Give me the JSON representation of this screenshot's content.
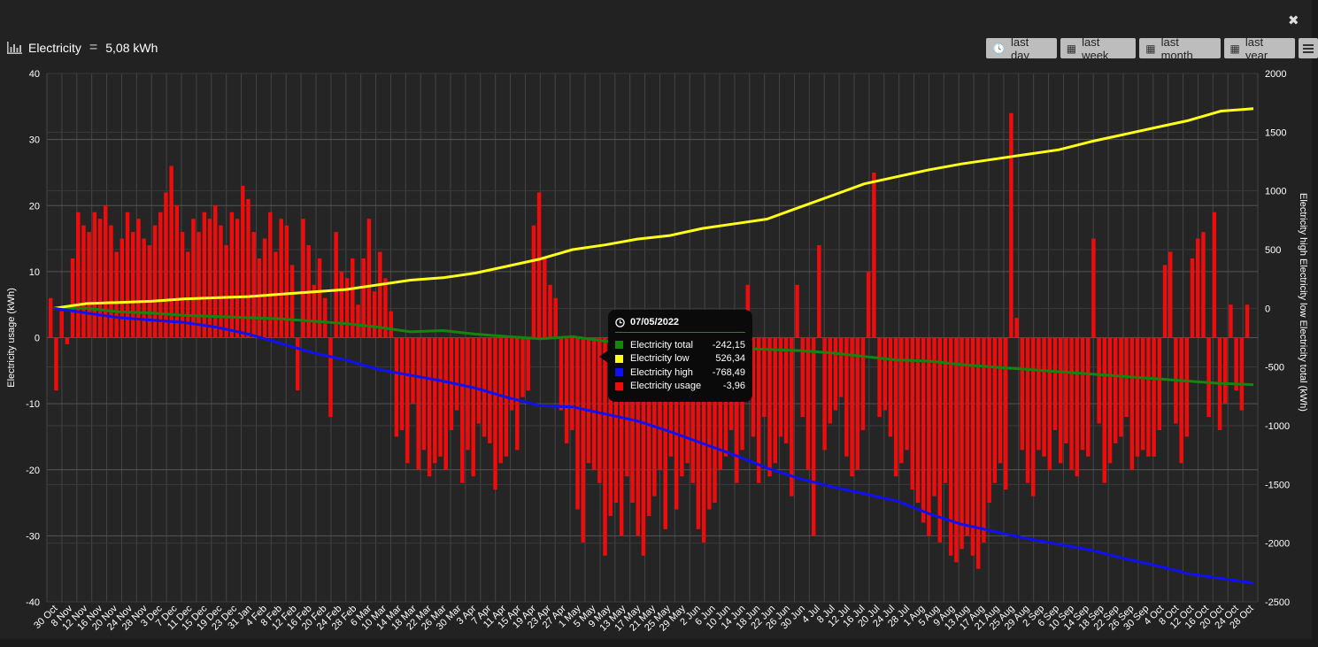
{
  "window": {
    "close_icon": "close-icon"
  },
  "header": {
    "icon": "bar-chart-icon",
    "title": "Electricity",
    "equals": "=",
    "value": "5,08 kWh"
  },
  "range_buttons": [
    {
      "label": "last day",
      "icon": "clock-icon"
    },
    {
      "label": "last week",
      "icon": "calendar-icon"
    },
    {
      "label": "last month",
      "icon": "calendar-icon"
    },
    {
      "label": "last year",
      "icon": "calendar-icon"
    }
  ],
  "menu_icon": "hamburger-menu-icon",
  "colors": {
    "total": "#14850f",
    "low": "#ffff1a",
    "high": "#1010f0",
    "usage": "#ee0c0c",
    "grid": "#4a4a4a",
    "background": "#222222"
  },
  "tooltip": {
    "date": "07/05/2022",
    "rows": [
      {
        "name": "Electricity total",
        "value": "-242,15",
        "color": "#14850f"
      },
      {
        "name": "Electricity low",
        "value": "526,34",
        "color": "#ffff1a"
      },
      {
        "name": "Electricity high",
        "value": "-768,49",
        "color": "#1010f0"
      },
      {
        "name": "Electricity usage",
        "value": "-3,96",
        "color": "#ee0c0c"
      }
    ]
  },
  "chart_data": {
    "type": "bar+line",
    "grid": true,
    "y_left": {
      "label": "Electricity usage (kWh)",
      "min": -40,
      "max": 40,
      "ticks": [
        40,
        30,
        20,
        10,
        0,
        -10,
        -20,
        -30,
        -40
      ]
    },
    "y_right": {
      "label": "Electricity high Electricity low Electricity total (kWh)",
      "min": -2500,
      "max": 2000,
      "ticks": [
        2000,
        1500,
        1000,
        500,
        0,
        -500,
        -1000,
        -1500,
        -2000,
        -2500
      ]
    },
    "x_ticks": [
      "30 Oct",
      "8 Nov",
      "12 Nov",
      "16 Nov",
      "20 Nov",
      "24 Nov",
      "28 Nov",
      "3 Dec",
      "7 Dec",
      "11 Dec",
      "15 Dec",
      "19 Dec",
      "23 Dec",
      "31 Jan",
      "4 Feb",
      "8 Feb",
      "12 Feb",
      "16 Feb",
      "20 Feb",
      "24 Feb",
      "28 Feb",
      "6 Mar",
      "10 Mar",
      "14 Mar",
      "18 Mar",
      "22 Mar",
      "26 Mar",
      "30 Mar",
      "3 Apr",
      "7 Apr",
      "11 Apr",
      "15 Apr",
      "19 Apr",
      "23 Apr",
      "27 Apr",
      "1 May",
      "5 May",
      "9 May",
      "13 May",
      "17 May",
      "21 May",
      "25 May",
      "29 May",
      "2 Jun",
      "6 Jun",
      "10 Jun",
      "14 Jun",
      "18 Jun",
      "22 Jun",
      "26 Jun",
      "30 Jun",
      "4 Jul",
      "8 Jul",
      "12 Jul",
      "16 Jul",
      "20 Jul",
      "24 Jul",
      "28 Jul",
      "1 Aug",
      "5 Aug",
      "9 Aug",
      "13 Aug",
      "17 Aug",
      "21 Aug",
      "25 Aug",
      "29 Aug",
      "2 Sep",
      "6 Sep",
      "10 Sep",
      "14 Sep",
      "18 Sep",
      "22 Sep",
      "26 Sep",
      "30 Sep",
      "4 Oct",
      "8 Oct",
      "12 Oct",
      "16 Oct",
      "20 Oct",
      "24 Oct",
      "28 Oct"
    ],
    "usage_weekly": [
      {
        "week": 1,
        "values": [
          6,
          -8,
          4,
          -1
        ]
      },
      {
        "week": 2,
        "values": [
          12,
          19,
          17,
          16,
          19
        ]
      },
      {
        "week": 3,
        "values": [
          18,
          20,
          17,
          13,
          15,
          19
        ]
      },
      {
        "week": 4,
        "values": [
          16,
          18,
          15,
          14,
          17,
          19
        ]
      },
      {
        "week": 5,
        "values": [
          22,
          26,
          20,
          16,
          13,
          18
        ]
      },
      {
        "week": 6,
        "values": [
          16,
          19,
          18,
          20,
          17,
          14
        ]
      },
      {
        "week": 7,
        "values": [
          19,
          18,
          23,
          21,
          16,
          12
        ]
      },
      {
        "week": 8,
        "values": [
          15,
          19,
          13,
          18,
          17,
          11
        ]
      },
      {
        "week": 9,
        "values": [
          -8,
          18,
          14,
          8,
          12,
          6
        ]
      },
      {
        "week": 10,
        "values": [
          -12,
          16,
          10,
          9,
          12,
          5
        ]
      },
      {
        "week": 11,
        "values": [
          12,
          18,
          7,
          13,
          9,
          4
        ]
      },
      {
        "week": 12,
        "values": [
          -15,
          -14,
          -19,
          -10,
          -20,
          -17
        ]
      },
      {
        "week": 13,
        "values": [
          -21,
          -19,
          -18,
          -20,
          -14,
          -11
        ]
      },
      {
        "week": 14,
        "values": [
          -22,
          -17,
          -21,
          -13,
          -15,
          -16
        ]
      },
      {
        "week": 15,
        "values": [
          -23,
          -19,
          -18,
          -11,
          -17,
          -9
        ]
      },
      {
        "week": 16,
        "values": [
          -8,
          17,
          22,
          12,
          8,
          6
        ]
      },
      {
        "week": 17,
        "values": [
          -11,
          -16,
          -14,
          -26,
          -31,
          -19
        ]
      },
      {
        "week": 18,
        "values": [
          -20,
          -22,
          -33,
          -27,
          -25,
          -30
        ]
      },
      {
        "week": 19,
        "values": [
          -21,
          -25,
          -30,
          -33,
          -27,
          -24
        ]
      },
      {
        "week": 20,
        "values": [
          -20,
          -29,
          -18,
          -26,
          -21,
          -19
        ]
      },
      {
        "week": 21,
        "values": [
          -22,
          -29,
          -31,
          -26,
          -25,
          -20
        ]
      },
      {
        "week": 22,
        "values": [
          -18,
          -14,
          -22,
          -17,
          8,
          -15
        ]
      },
      {
        "week": 23,
        "values": [
          -22,
          -12,
          -21,
          -19,
          -15,
          -16
        ]
      },
      {
        "week": 24,
        "values": [
          -24,
          8,
          -12,
          -20,
          -30,
          14
        ]
      },
      {
        "week": 25,
        "values": [
          -17,
          -13,
          -11,
          -9,
          -18,
          -21
        ]
      },
      {
        "week": 26,
        "values": [
          -20,
          -14,
          10,
          25,
          -12,
          -11
        ]
      },
      {
        "week": 27,
        "values": [
          -15,
          -21,
          -19,
          -17,
          -23,
          -25
        ]
      },
      {
        "week": 28,
        "values": [
          -28,
          -30,
          -24,
          -31,
          -22,
          -33
        ]
      },
      {
        "week": 29,
        "values": [
          -34,
          -32,
          -30,
          -33,
          -35,
          -31
        ]
      },
      {
        "week": 30,
        "values": [
          -25,
          -22,
          -19,
          -23,
          34,
          3
        ]
      },
      {
        "week": 31,
        "values": [
          -17,
          -22,
          -24,
          -17,
          -18,
          -20
        ]
      },
      {
        "week": 32,
        "values": [
          -14,
          -19,
          -16,
          -20,
          -21,
          -17
        ]
      },
      {
        "week": 33,
        "values": [
          -18,
          15,
          -13,
          -22,
          -19,
          -16
        ]
      },
      {
        "week": 34,
        "values": [
          -15,
          -12,
          -20,
          -18,
          -17,
          -18
        ]
      },
      {
        "week": 35,
        "values": [
          -18,
          -14,
          11,
          13,
          -13,
          -19
        ]
      },
      {
        "week": 36,
        "values": [
          -15,
          12,
          15,
          16,
          -12,
          19
        ]
      },
      {
        "week": 37,
        "values": [
          -14,
          -10,
          5,
          -8,
          -11,
          5
        ]
      }
    ],
    "series": [
      {
        "name": "Electricity total",
        "axis": "right",
        "values": [
          0,
          0,
          -30,
          -40,
          -60,
          -70,
          -80,
          -90,
          -110,
          -130,
          -160,
          -200,
          -190,
          -220,
          -240,
          -260,
          -242,
          -280,
          -300,
          -320,
          -300,
          -340,
          -350,
          -360,
          -380,
          -410,
          -440,
          -450,
          -480,
          -500,
          -520,
          -540,
          -560,
          -580,
          -600,
          -620,
          -640,
          -650
        ]
      },
      {
        "name": "Electricity low",
        "axis": "right",
        "values": [
          0,
          40,
          50,
          60,
          80,
          90,
          100,
          120,
          140,
          160,
          200,
          240,
          260,
          300,
          360,
          420,
          500,
          540,
          590,
          620,
          680,
          720,
          760,
          860,
          960,
          1060,
          1120,
          1180,
          1230,
          1270,
          1310,
          1350,
          1420,
          1480,
          1540,
          1600,
          1680,
          1700
        ]
      },
      {
        "name": "Electricity high",
        "axis": "right",
        "values": [
          0,
          -40,
          -80,
          -100,
          -120,
          -160,
          -220,
          -300,
          -380,
          -440,
          -520,
          -570,
          -620,
          -680,
          -760,
          -830,
          -840,
          -900,
          -960,
          -1050,
          -1150,
          -1250,
          -1360,
          -1450,
          -1520,
          -1580,
          -1640,
          -1750,
          -1840,
          -1900,
          -1960,
          -2010,
          -2060,
          -2130,
          -2190,
          -2260,
          -2300,
          -2340
        ]
      }
    ]
  }
}
